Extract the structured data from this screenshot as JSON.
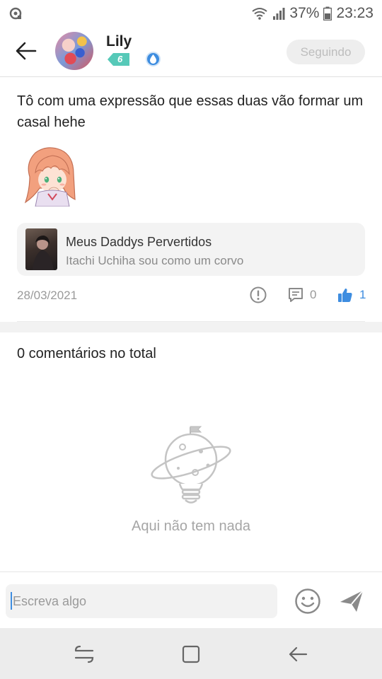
{
  "status_bar": {
    "battery": "37%",
    "time": "23:23",
    "icons": [
      "record-icon",
      "wifi-icon",
      "signal-icon",
      "battery-icon"
    ]
  },
  "header": {
    "back_icon": "arrow-left-icon",
    "username": "Lily",
    "level": "6",
    "follow_label": "Seguindo"
  },
  "post": {
    "text": "Tô com uma expressão que essas duas vão  formar um casal hehe",
    "community": {
      "name": "Meus Daddys Pervertidos",
      "description": "Itachi Uchiha sou como um corvo"
    },
    "date": "28/03/2021",
    "comment_count": "0",
    "like_count": "1"
  },
  "comments": {
    "title": "0 comentários no total",
    "empty_text": "Aqui não tem nada"
  },
  "input": {
    "placeholder": "Escreva algo"
  },
  "colors": {
    "accent": "#3e8de0",
    "level_badge": "#56c9b8",
    "muted_text": "#9a9a9a"
  }
}
